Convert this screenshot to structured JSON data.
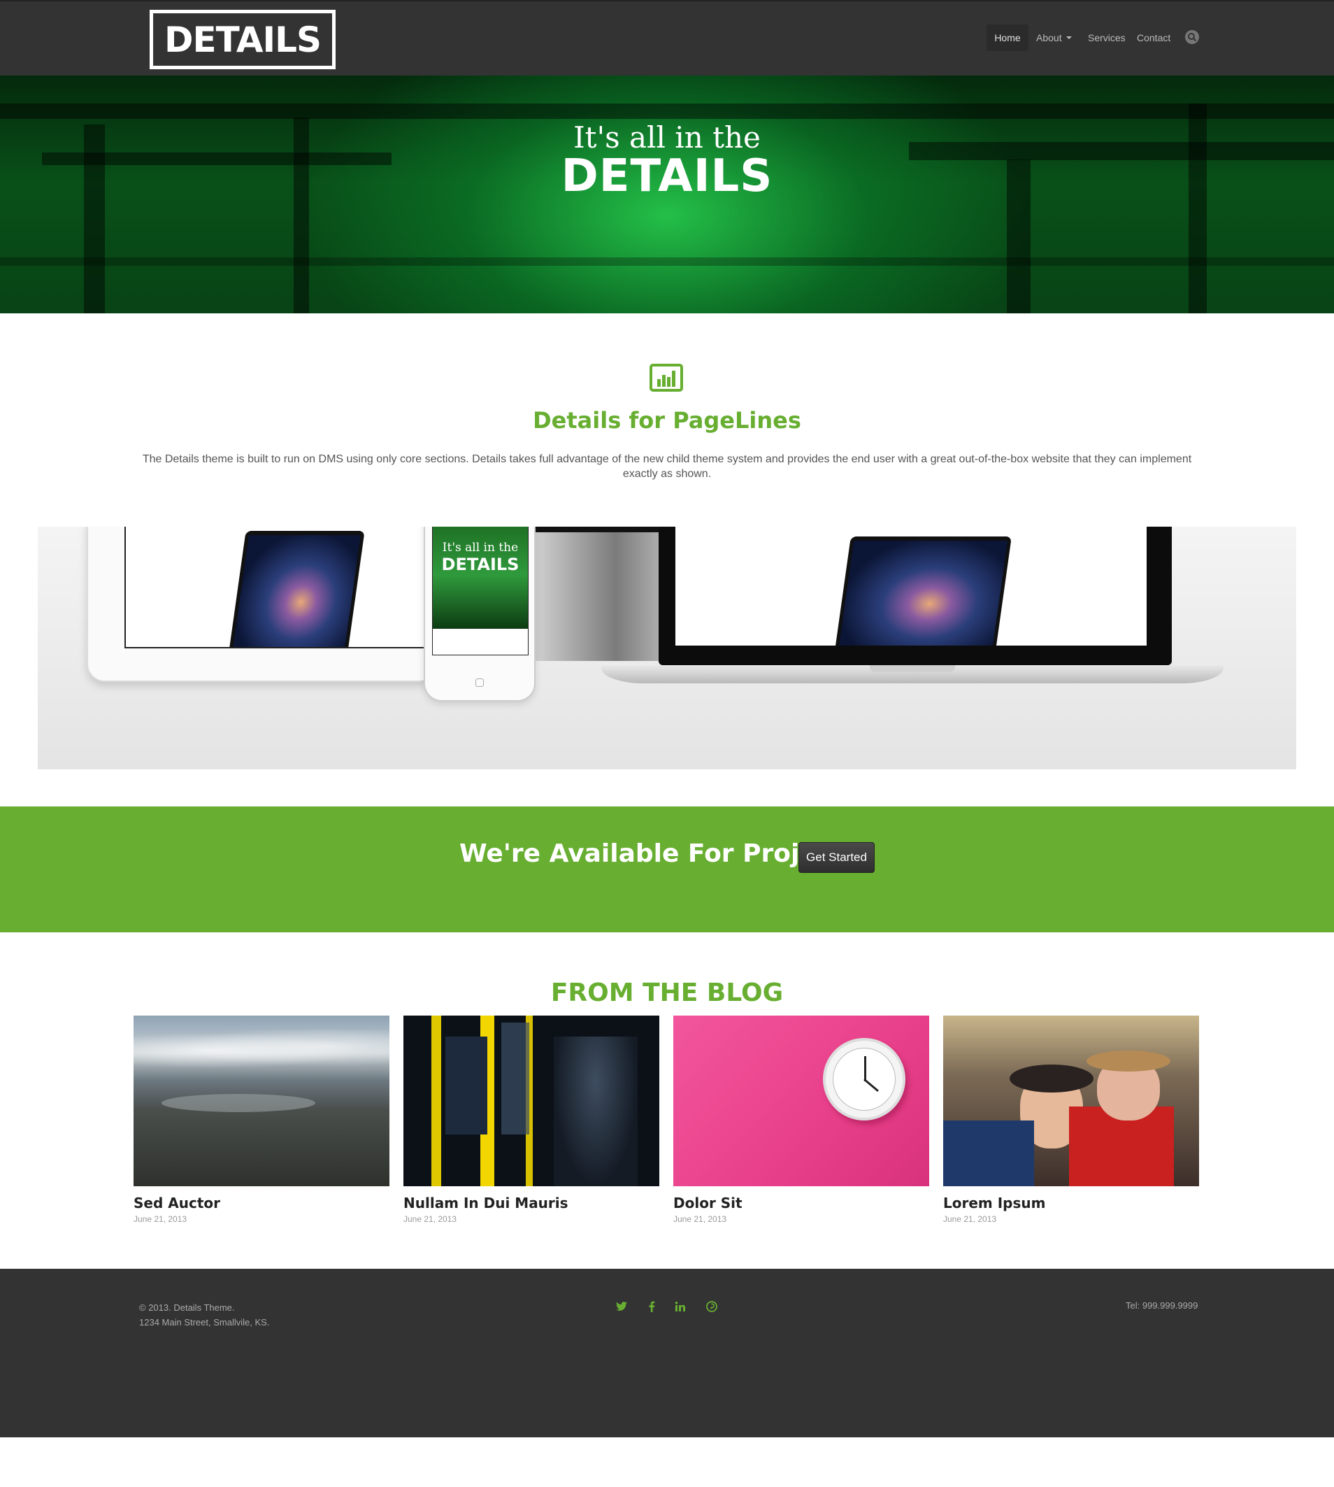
{
  "header": {
    "logo": "DETAILS",
    "nav": {
      "home": "Home",
      "about": "About",
      "services": "Services",
      "contact": "Contact"
    }
  },
  "hero": {
    "line1": "It's all in the",
    "line2": "DETAILS"
  },
  "intro": {
    "icon": "bar-chart-icon",
    "title": "Details for PageLines",
    "text": "The Details theme is built to run on DMS using only core sections. Details takes full advantage of the new child theme system and provides the end user with a great out-of-the-box website that they can implement exactly as shown."
  },
  "devices_phone": {
    "line1": "It's all in the",
    "line2": "DETAILS"
  },
  "cta": {
    "text": "We're Available For Projects.",
    "button": "Get Started"
  },
  "blog": {
    "title": "FROM THE BLOG",
    "posts": [
      {
        "title": "Sed Auctor",
        "date": "June 21, 2013"
      },
      {
        "title": "Nullam In Dui Mauris",
        "date": "June 21, 2013"
      },
      {
        "title": "Dolor Sit",
        "date": "June 21, 2013"
      },
      {
        "title": "Lorem Ipsum",
        "date": "June 21, 2013"
      }
    ]
  },
  "footer": {
    "copyright": "© 2013. Details Theme.",
    "address": "1234 Main Street, Smallvile, KS.",
    "phone": "Tel: 999.999.9999",
    "social": [
      "twitter-icon",
      "facebook-icon",
      "linkedin-icon",
      "pinterest-icon"
    ]
  },
  "colors": {
    "accent": "#67ae31",
    "dark": "#333333"
  }
}
